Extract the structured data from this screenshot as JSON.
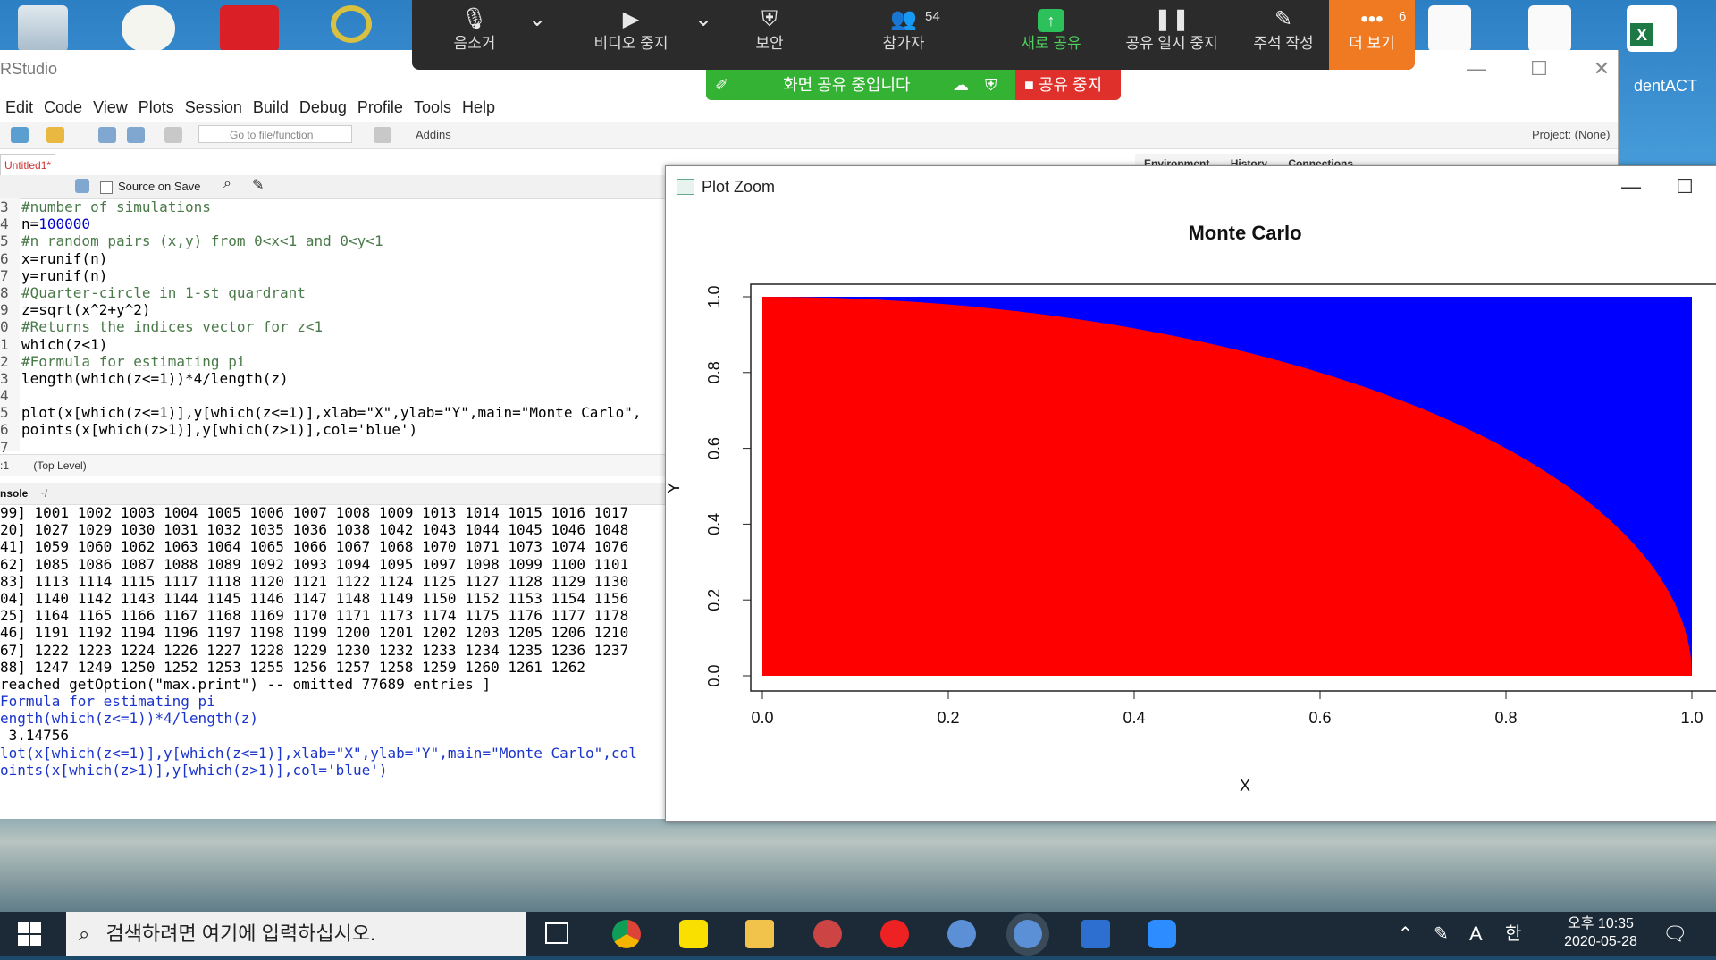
{
  "rstudio": {
    "title": "RStudio",
    "menu": [
      "Edit",
      "Code",
      "View",
      "Plots",
      "Session",
      "Build",
      "Debug",
      "Profile",
      "Tools",
      "Help"
    ],
    "goto_placeholder": "Go to file/function",
    "addins": "Addins",
    "project": "Project: (None)",
    "editor_tab": "Untitled1*",
    "source_on_save": "Source on Save",
    "code_lines": [
      {
        "n": "3",
        "text": "#number of simulations",
        "kind": "comment"
      },
      {
        "n": "4",
        "pre": "n=",
        "num": "100000",
        "kind": "assign"
      },
      {
        "n": "5",
        "text": "#n random pairs (x,y) from 0<x<1 and 0<y<1",
        "kind": "comment"
      },
      {
        "n": "6",
        "text": "x=runif(n)",
        "kind": "code"
      },
      {
        "n": "7",
        "text": "y=runif(n)",
        "kind": "code"
      },
      {
        "n": "8",
        "text": "#Quarter-circle in 1-st quardrant",
        "kind": "comment"
      },
      {
        "n": "9",
        "text": "z=sqrt(x^2+y^2)",
        "kind": "code"
      },
      {
        "n": "0",
        "text": "#Returns the indices vector for z<1",
        "kind": "comment"
      },
      {
        "n": "1",
        "text": "which(z<1)",
        "kind": "code"
      },
      {
        "n": "2",
        "text": "#Formula for estimating pi",
        "kind": "comment"
      },
      {
        "n": "3",
        "text": "length(which(z<=1))*4/length(z)",
        "kind": "code"
      },
      {
        "n": "4",
        "text": "",
        "kind": "code"
      },
      {
        "n": "5",
        "text": "plot(x[which(z<=1)],y[which(z<=1)],xlab=\"X\",ylab=\"Y\",main=\"Monte Carlo\",",
        "kind": "code"
      },
      {
        "n": "6",
        "text": "points(x[which(z>1)],y[which(z>1)],col='blue')",
        "kind": "code"
      },
      {
        "n": "7",
        "text": "",
        "kind": "code"
      }
    ],
    "status_pos": ":1",
    "status_level": "(Top Level)",
    "console_label": "nsole",
    "console_path": "~/",
    "console_lines": [
      {
        "text": "99] 1001 1002 1003 1004 1005 1006 1007 1008 1009 1013 1014 1015 1016 1017",
        "blue": false
      },
      {
        "text": "20] 1027 1029 1030 1031 1032 1035 1036 1038 1042 1043 1044 1045 1046 1048",
        "blue": false
      },
      {
        "text": "41] 1059 1060 1062 1063 1064 1065 1066 1067 1068 1070 1071 1073 1074 1076",
        "blue": false
      },
      {
        "text": "62] 1085 1086 1087 1088 1089 1092 1093 1094 1095 1097 1098 1099 1100 1101",
        "blue": false
      },
      {
        "text": "83] 1113 1114 1115 1117 1118 1120 1121 1122 1124 1125 1127 1128 1129 1130",
        "blue": false
      },
      {
        "text": "04] 1140 1142 1143 1144 1145 1146 1147 1148 1149 1150 1152 1153 1154 1156",
        "blue": false
      },
      {
        "text": "25] 1164 1165 1166 1167 1168 1169 1170 1171 1173 1174 1175 1176 1177 1178",
        "blue": false
      },
      {
        "text": "46] 1191 1192 1194 1196 1197 1198 1199 1200 1201 1202 1203 1205 1206 1210",
        "blue": false
      },
      {
        "text": "67] 1222 1223 1224 1226 1227 1228 1229 1230 1232 1233 1234 1235 1236 1237",
        "blue": false
      },
      {
        "text": "88] 1247 1249 1250 1252 1253 1255 1256 1257 1258 1259 1260 1261 1262",
        "blue": false
      },
      {
        "text": "reached getOption(\"max.print\") -- omitted 77689 entries ]",
        "blue": false
      },
      {
        "text": "Formula for estimating pi",
        "blue": true
      },
      {
        "text": "ength(which(z<=1))*4/length(z)",
        "blue": true
      },
      {
        "text": " 3.14756",
        "blue": false
      },
      {
        "text": "lot(x[which(z<=1)],y[which(z<=1)],xlab=\"X\",ylab=\"Y\",main=\"Monte Carlo\",col",
        "blue": true
      },
      {
        "text": "oints(x[which(z>1)],y[which(z>1)],col='blue')",
        "blue": true
      }
    ],
    "right_tabs": [
      "Environment",
      "History",
      "Connections"
    ]
  },
  "plot_zoom": {
    "title": "Plot Zoom"
  },
  "chart_data": {
    "type": "scatter",
    "title": "Monte Carlo",
    "xlabel": "X",
    "ylabel": "Y",
    "xlim": [
      0,
      1
    ],
    "ylim": [
      0,
      1
    ],
    "x_ticks": [
      "0.0",
      "0.2",
      "0.4",
      "0.6",
      "0.8",
      "1.0"
    ],
    "y_ticks": [
      "0.0",
      "0.2",
      "0.4",
      "0.6",
      "0.8",
      "1.0"
    ],
    "series": [
      {
        "region": "x^2+y^2<=1",
        "color": "#ff0000"
      },
      {
        "region": "x^2+y^2>1",
        "color": "#0000ff"
      }
    ],
    "grid": false
  },
  "zoom": {
    "items": [
      {
        "label": "음소거",
        "icon": "mic-icon"
      },
      {
        "label": "비디오 중지",
        "icon": "video-icon"
      },
      {
        "label": "보안",
        "icon": "shield-icon"
      },
      {
        "label": "참가자",
        "icon": "participants-icon",
        "badge": "54"
      },
      {
        "label": "새로 공유",
        "icon": "share-icon"
      },
      {
        "label": "공유 일시 중지",
        "icon": "pause-icon"
      },
      {
        "label": "주석 작성",
        "icon": "pen-icon"
      },
      {
        "label": "더 보기",
        "icon": "more-icon",
        "badge": "6"
      }
    ],
    "sharing_banner": "화면 공유 중입니다",
    "stop_share": "공유 중지"
  },
  "desktop": {
    "excel_label": "dentACT"
  },
  "taskbar": {
    "search_placeholder": "검색하려면 여기에 입력하십시오.",
    "ime": "A",
    "ime2": "한",
    "time": "오후 10:35",
    "date": "2020-05-28"
  },
  "colors": {
    "zoom_bg": "#2b2b2b",
    "zoom_more": "#f07a22",
    "share_green": "#34b233",
    "stop_red": "#e0302c"
  }
}
